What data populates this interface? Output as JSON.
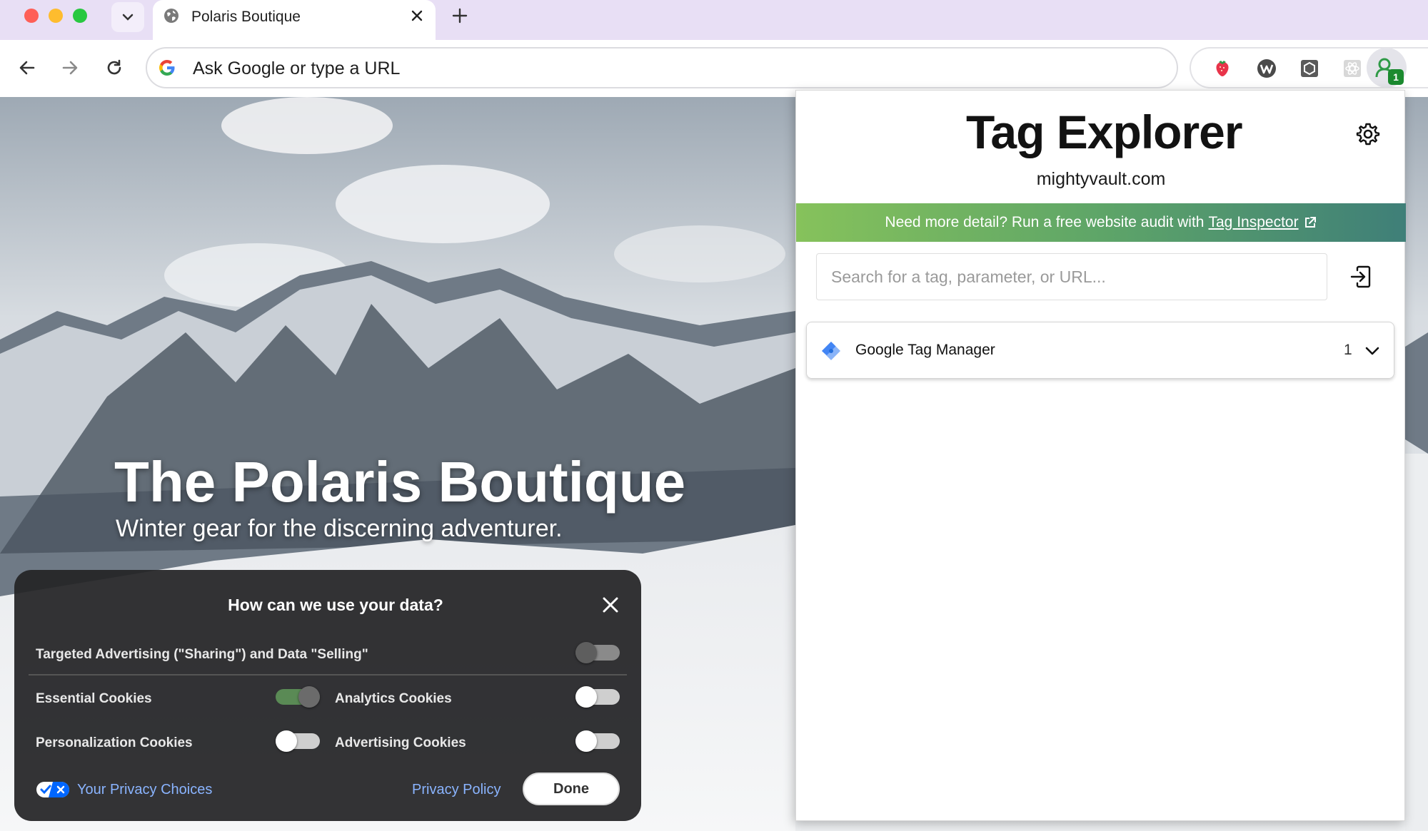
{
  "browser": {
    "tab": {
      "title": "Polaris Boutique"
    },
    "omnibox": {
      "placeholder": "Ask Google or type a URL"
    }
  },
  "page": {
    "hero_title": "The Polaris Boutique",
    "hero_subtitle": "Winter gear for the discerning adventurer."
  },
  "cookie_banner": {
    "title": "How can we use your data?",
    "targeted_label": "Targeted Advertising (\"Sharing\") and Data \"Selling\"",
    "essential_label": "Essential Cookies",
    "analytics_label": "Analytics Cookies",
    "personalization_label": "Personalization Cookies",
    "advertising_label": "Advertising Cookies",
    "privacy_choices": "Your Privacy Choices",
    "privacy_policy": "Privacy Policy",
    "done": "Done"
  },
  "extension": {
    "logo": "Tag Explorer",
    "domain": "mightyvault.com",
    "promo_text": "Need more detail? Run a free website audit with",
    "promo_link": "Tag Inspector",
    "search_placeholder": "Search for a tag, parameter, or URL...",
    "badge_count": "1",
    "tags": [
      {
        "name": "Google Tag Manager",
        "count": "1"
      }
    ]
  },
  "colors": {
    "brand_green": "#3fa34d",
    "promo_gradient_start": "#86c25b",
    "promo_gradient_end": "#3f7f78",
    "link_blue": "#8ab4ff",
    "tab_strip": "#e8dff5"
  }
}
